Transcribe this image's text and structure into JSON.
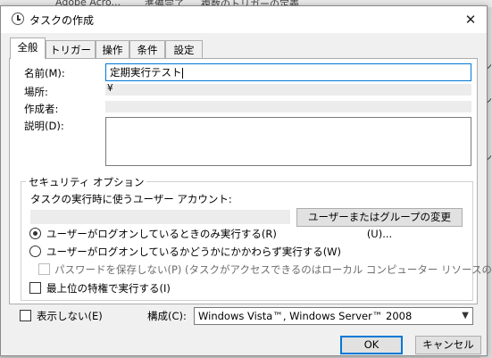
{
  "background": {
    "top_texts": [
      "Adobe Acro...",
      "準備完了",
      "複数のトリガーの定義"
    ],
    "right_chars": [
      "ン",
      "ン",
      "ン"
    ]
  },
  "dialog": {
    "title": "タスクの作成",
    "close_symbol": "✕"
  },
  "tabs": [
    {
      "label": "全般",
      "active": true
    },
    {
      "label": "トリガー",
      "active": false
    },
    {
      "label": "操作",
      "active": false
    },
    {
      "label": "条件",
      "active": false
    },
    {
      "label": "設定",
      "active": false
    }
  ],
  "general": {
    "name_label": "名前(M):",
    "name_value": "定期実行テスト",
    "location_label": "場所:",
    "location_value": "¥",
    "author_label": "作成者:",
    "description_label": "説明(D):"
  },
  "security": {
    "group_label": "セキュリティ オプション",
    "account_prompt": "タスクの実行時に使うユーザー アカウント:",
    "change_button": "ユーザーまたはグループの変更(U)...",
    "radio_logged_on": "ユーザーがログオンしているときのみ実行する(R)",
    "radio_whether": "ユーザーがログオンしているかどうかにかかわらず実行する(W)",
    "no_password": "パスワードを保存しない(P) (タスクがアクセスできるのはローカル コンピューター リソースのみ)",
    "highest_privileges": "最上位の特権で実行する(I)"
  },
  "footer": {
    "hidden_label": "表示しない(E)",
    "config_label": "構成(C):",
    "config_value": "Windows Vista™, Windows Server™ 2008",
    "ok": "OK",
    "cancel": "キャンセル"
  }
}
